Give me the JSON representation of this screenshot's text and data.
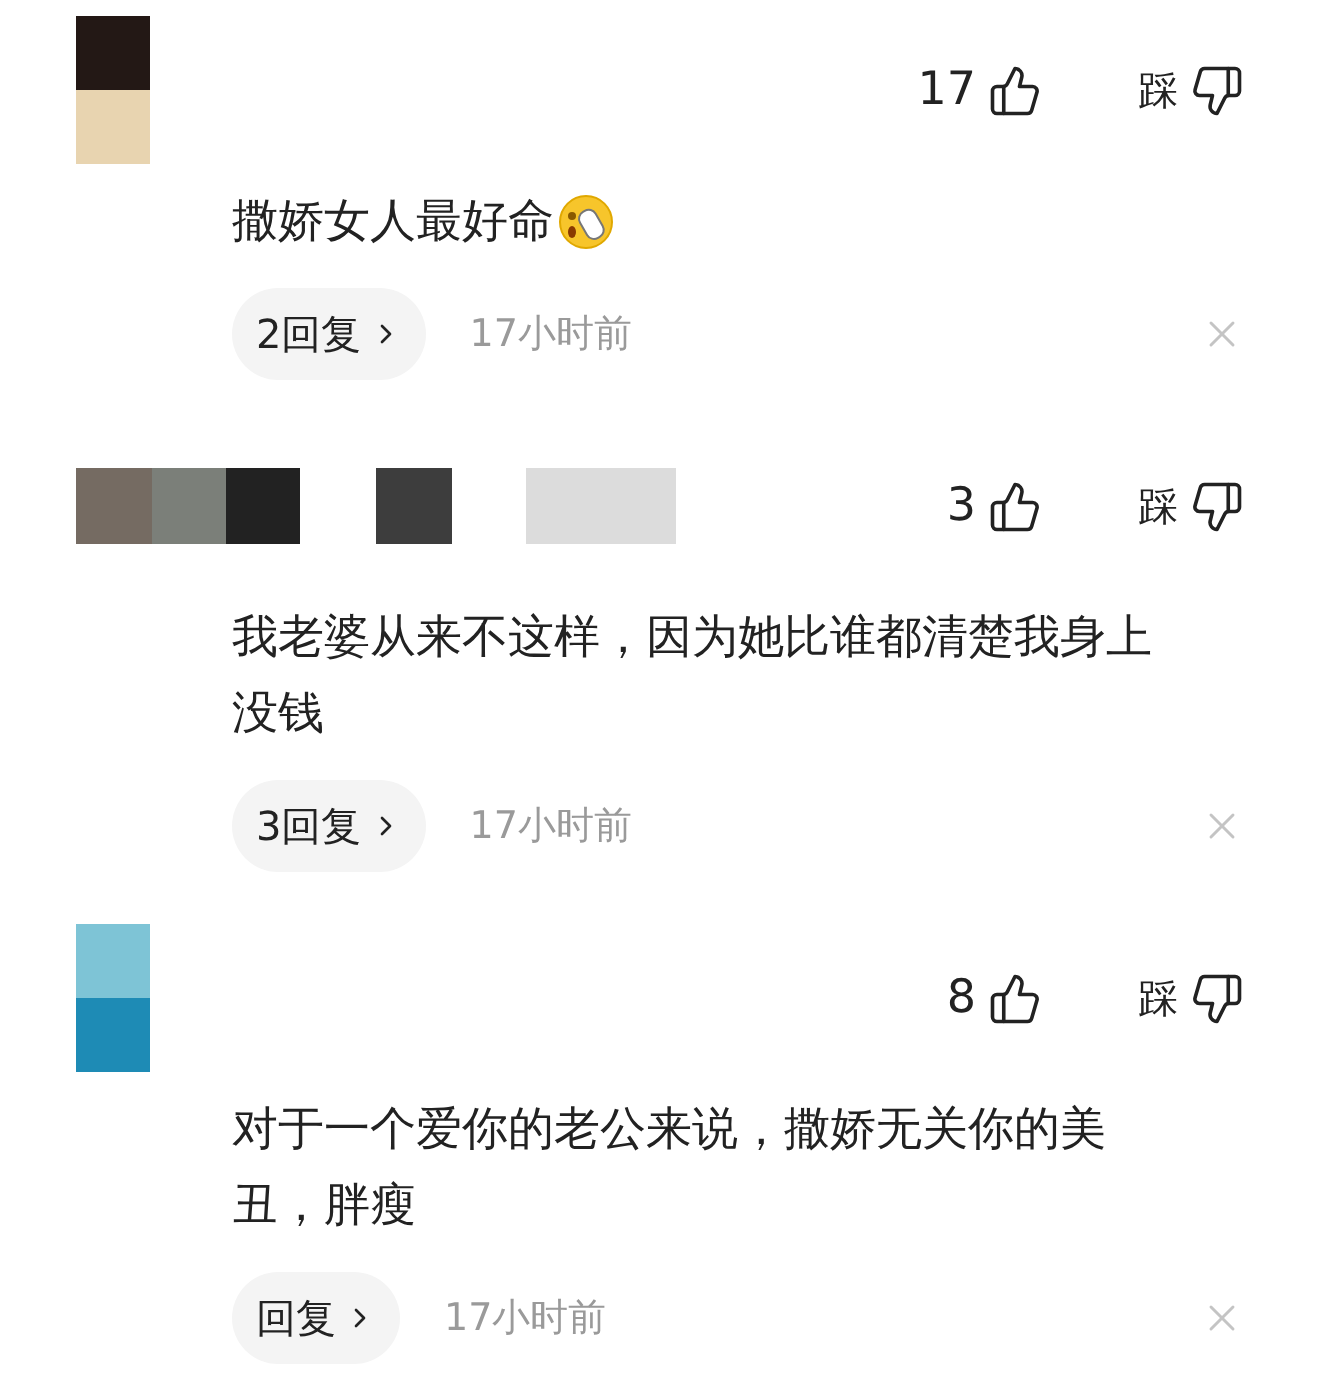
{
  "comments": [
    {
      "likes": "17",
      "dislike_label": "踩",
      "text": "撒娇女人最好命",
      "emoji": true,
      "replies": "2回复",
      "time": "17小时前"
    },
    {
      "likes": "3",
      "dislike_label": "踩",
      "text": "我老婆从来不这样，因为她比谁都清楚我身上没钱",
      "emoji": false,
      "replies": "3回复",
      "time": "17小时前"
    },
    {
      "likes": "8",
      "dislike_label": "踩",
      "text": "对于一个爱你的老公来说，撒娇无关你的美丑，胖瘦",
      "emoji": false,
      "replies": "回复",
      "time": "17小时前"
    }
  ]
}
